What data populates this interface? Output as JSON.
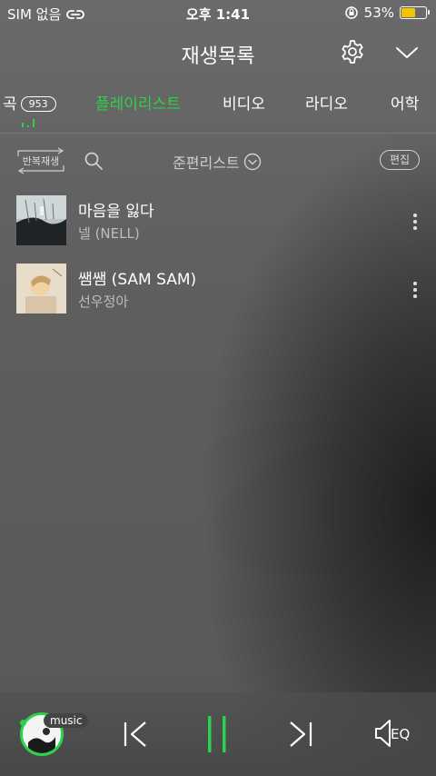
{
  "status": {
    "carrier": "SIM 없음",
    "time": "오후 1:41",
    "battery": "53%",
    "battery_level": 0.53,
    "battery_color": "#f5c400"
  },
  "header": {
    "title": "재생목록"
  },
  "tabs": {
    "songs": "곡",
    "songs_count": "953",
    "playlist": "플레이리스트",
    "video": "비디오",
    "radio": "라디오",
    "language": "어학"
  },
  "toolbar": {
    "repeat": "반복재생",
    "prelist": "준편리스트",
    "edit": "편집"
  },
  "items": [
    {
      "title": "마음을 잃다",
      "artist": "넬 (NELL)"
    },
    {
      "title": "쌤쌤 (SAM SAM)",
      "artist": "선우정아"
    }
  ],
  "player": {
    "tag": "music"
  },
  "colors": {
    "accent": "#2bd348"
  },
  "icons": [
    "link-icon",
    "rotation-lock-icon",
    "gear-icon",
    "chevron-down-icon",
    "search-icon",
    "repeat-icon",
    "more-icon",
    "previous-icon",
    "pause-icon",
    "next-icon",
    "eq-icon"
  ]
}
